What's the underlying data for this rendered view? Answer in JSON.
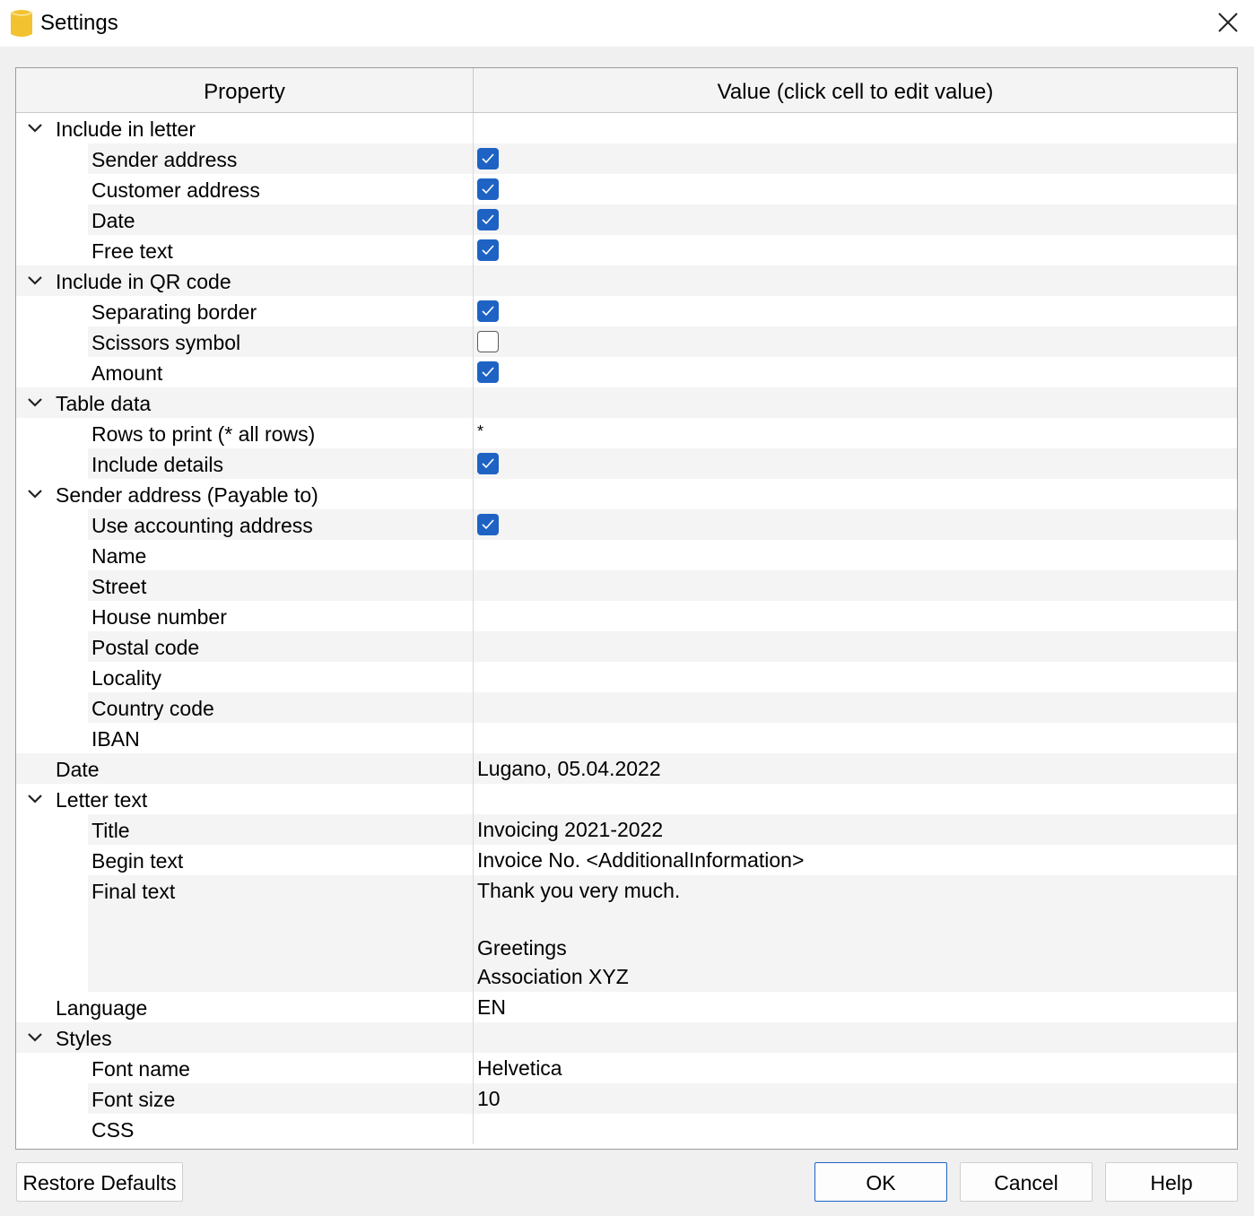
{
  "window": {
    "title": "Settings"
  },
  "table": {
    "header_property": "Property",
    "header_value": "Value (click cell to edit value)"
  },
  "rows": [
    {
      "kind": "group",
      "label": "Include in letter",
      "expanded": true
    },
    {
      "kind": "child",
      "label": "Sender address",
      "value_type": "checkbox",
      "checked": true
    },
    {
      "kind": "child",
      "label": "Customer address",
      "value_type": "checkbox",
      "checked": true
    },
    {
      "kind": "child",
      "label": "Date",
      "value_type": "checkbox",
      "checked": true
    },
    {
      "kind": "child",
      "label": "Free text",
      "value_type": "checkbox",
      "checked": true
    },
    {
      "kind": "group",
      "label": "Include in QR code",
      "expanded": true
    },
    {
      "kind": "child",
      "label": "Separating border",
      "value_type": "checkbox",
      "checked": true
    },
    {
      "kind": "child",
      "label": "Scissors symbol",
      "value_type": "checkbox",
      "checked": false
    },
    {
      "kind": "child",
      "label": "Amount",
      "value_type": "checkbox",
      "checked": true
    },
    {
      "kind": "group",
      "label": "Table data",
      "expanded": true
    },
    {
      "kind": "child",
      "label": "Rows to print (* all rows)",
      "value_type": "text",
      "value": "*",
      "small": true
    },
    {
      "kind": "child",
      "label": "Include details",
      "value_type": "checkbox",
      "checked": true
    },
    {
      "kind": "group",
      "label": "Sender address (Payable to)",
      "expanded": true
    },
    {
      "kind": "child",
      "label": "Use accounting address",
      "value_type": "checkbox",
      "checked": true
    },
    {
      "kind": "child",
      "label": "Name",
      "value_type": "text",
      "value": ""
    },
    {
      "kind": "child",
      "label": "Street",
      "value_type": "text",
      "value": ""
    },
    {
      "kind": "child",
      "label": "House number",
      "value_type": "text",
      "value": ""
    },
    {
      "kind": "child",
      "label": "Postal code",
      "value_type": "text",
      "value": ""
    },
    {
      "kind": "child",
      "label": "Locality",
      "value_type": "text",
      "value": ""
    },
    {
      "kind": "child",
      "label": "Country code",
      "value_type": "text",
      "value": ""
    },
    {
      "kind": "child",
      "label": "IBAN",
      "value_type": "text",
      "value": ""
    },
    {
      "kind": "item",
      "label": "Date",
      "value_type": "text",
      "value": "Lugano, 05.04.2022"
    },
    {
      "kind": "group",
      "label": "Letter text",
      "expanded": true
    },
    {
      "kind": "child",
      "label": "Title",
      "value_type": "text",
      "value": "Invoicing 2021-2022"
    },
    {
      "kind": "child",
      "label": "Begin text",
      "value_type": "text",
      "value": "Invoice No. <AdditionalInformation>"
    },
    {
      "kind": "child",
      "label": "Final text",
      "value_type": "text",
      "value": "Thank you very much.\n\nGreetings\nAssociation XYZ",
      "tall": true
    },
    {
      "kind": "item",
      "label": "Language",
      "value_type": "text",
      "value": "EN"
    },
    {
      "kind": "group",
      "label": "Styles",
      "expanded": true
    },
    {
      "kind": "child",
      "label": "Font name",
      "value_type": "text",
      "value": "Helvetica"
    },
    {
      "kind": "child",
      "label": "Font size",
      "value_type": "text",
      "value": "10"
    },
    {
      "kind": "child",
      "label": "CSS",
      "value_type": "text",
      "value": ""
    }
  ],
  "buttons": {
    "restore_defaults": "Restore Defaults",
    "ok": "OK",
    "cancel": "Cancel",
    "help": "Help"
  },
  "colors": {
    "accent": "#1e63c4",
    "app_icon": "#f2c230",
    "row_alt": "#f4f4f4"
  }
}
